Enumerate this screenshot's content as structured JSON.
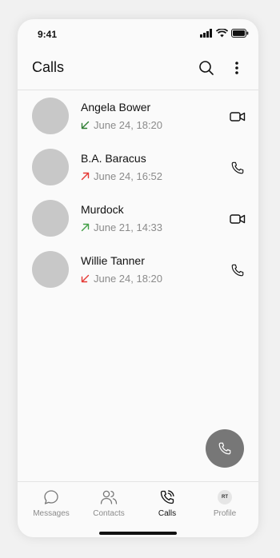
{
  "status_bar": {
    "time": "9:41"
  },
  "header": {
    "title": "Calls"
  },
  "calls": [
    {
      "name": "Angela Bower",
      "date": "June 24, 18:20",
      "direction": "incoming",
      "direction_color": "#2e7d32",
      "action": "video"
    },
    {
      "name": "B.A. Baracus",
      "date": "June 24, 16:52",
      "direction": "outgoing",
      "direction_color": "#e53935",
      "action": "voice"
    },
    {
      "name": "Murdock",
      "date": "June 21, 14:33",
      "direction": "outgoing",
      "direction_color": "#43a047",
      "action": "video"
    },
    {
      "name": "Willie Tanner",
      "date": "June 24, 18:20",
      "direction": "incoming",
      "direction_color": "#e53935",
      "action": "voice"
    }
  ],
  "nav": [
    {
      "label": "Messages",
      "icon": "chat-bubble-icon",
      "active": false
    },
    {
      "label": "Contacts",
      "icon": "contacts-icon",
      "active": false
    },
    {
      "label": "Calls",
      "icon": "phone-icon",
      "active": true
    },
    {
      "label": "Profile",
      "icon": "avatar",
      "active": false,
      "initials": "RT"
    }
  ],
  "colors": {
    "fab": "#777777",
    "avatar_placeholder": "#c8c8c8",
    "secondary_text": "#8b8b8b"
  }
}
